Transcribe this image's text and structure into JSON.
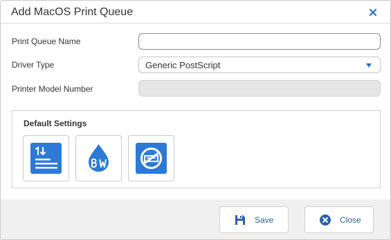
{
  "dialog": {
    "title": "Add MacOS Print Queue"
  },
  "form": {
    "queue_name": {
      "label": "Print Queue Name",
      "value": "",
      "placeholder": ""
    },
    "driver_type": {
      "label": "Driver Type",
      "selected": "Generic PostScript"
    },
    "model_number": {
      "label": "Printer Model Number",
      "value": ""
    }
  },
  "default_settings": {
    "title": "Default Settings",
    "tiles": [
      {
        "name": "sort-order-icon"
      },
      {
        "name": "black-white-ink-icon"
      },
      {
        "name": "no-staple-icon"
      }
    ]
  },
  "footer": {
    "save_label": "Save",
    "close_label": "Close"
  },
  "colors": {
    "accent": "#2a6fc9",
    "icon_blue": "#2c7ad6",
    "footer_bg": "#f0f0f0",
    "button_text": "#2a5fa3"
  }
}
